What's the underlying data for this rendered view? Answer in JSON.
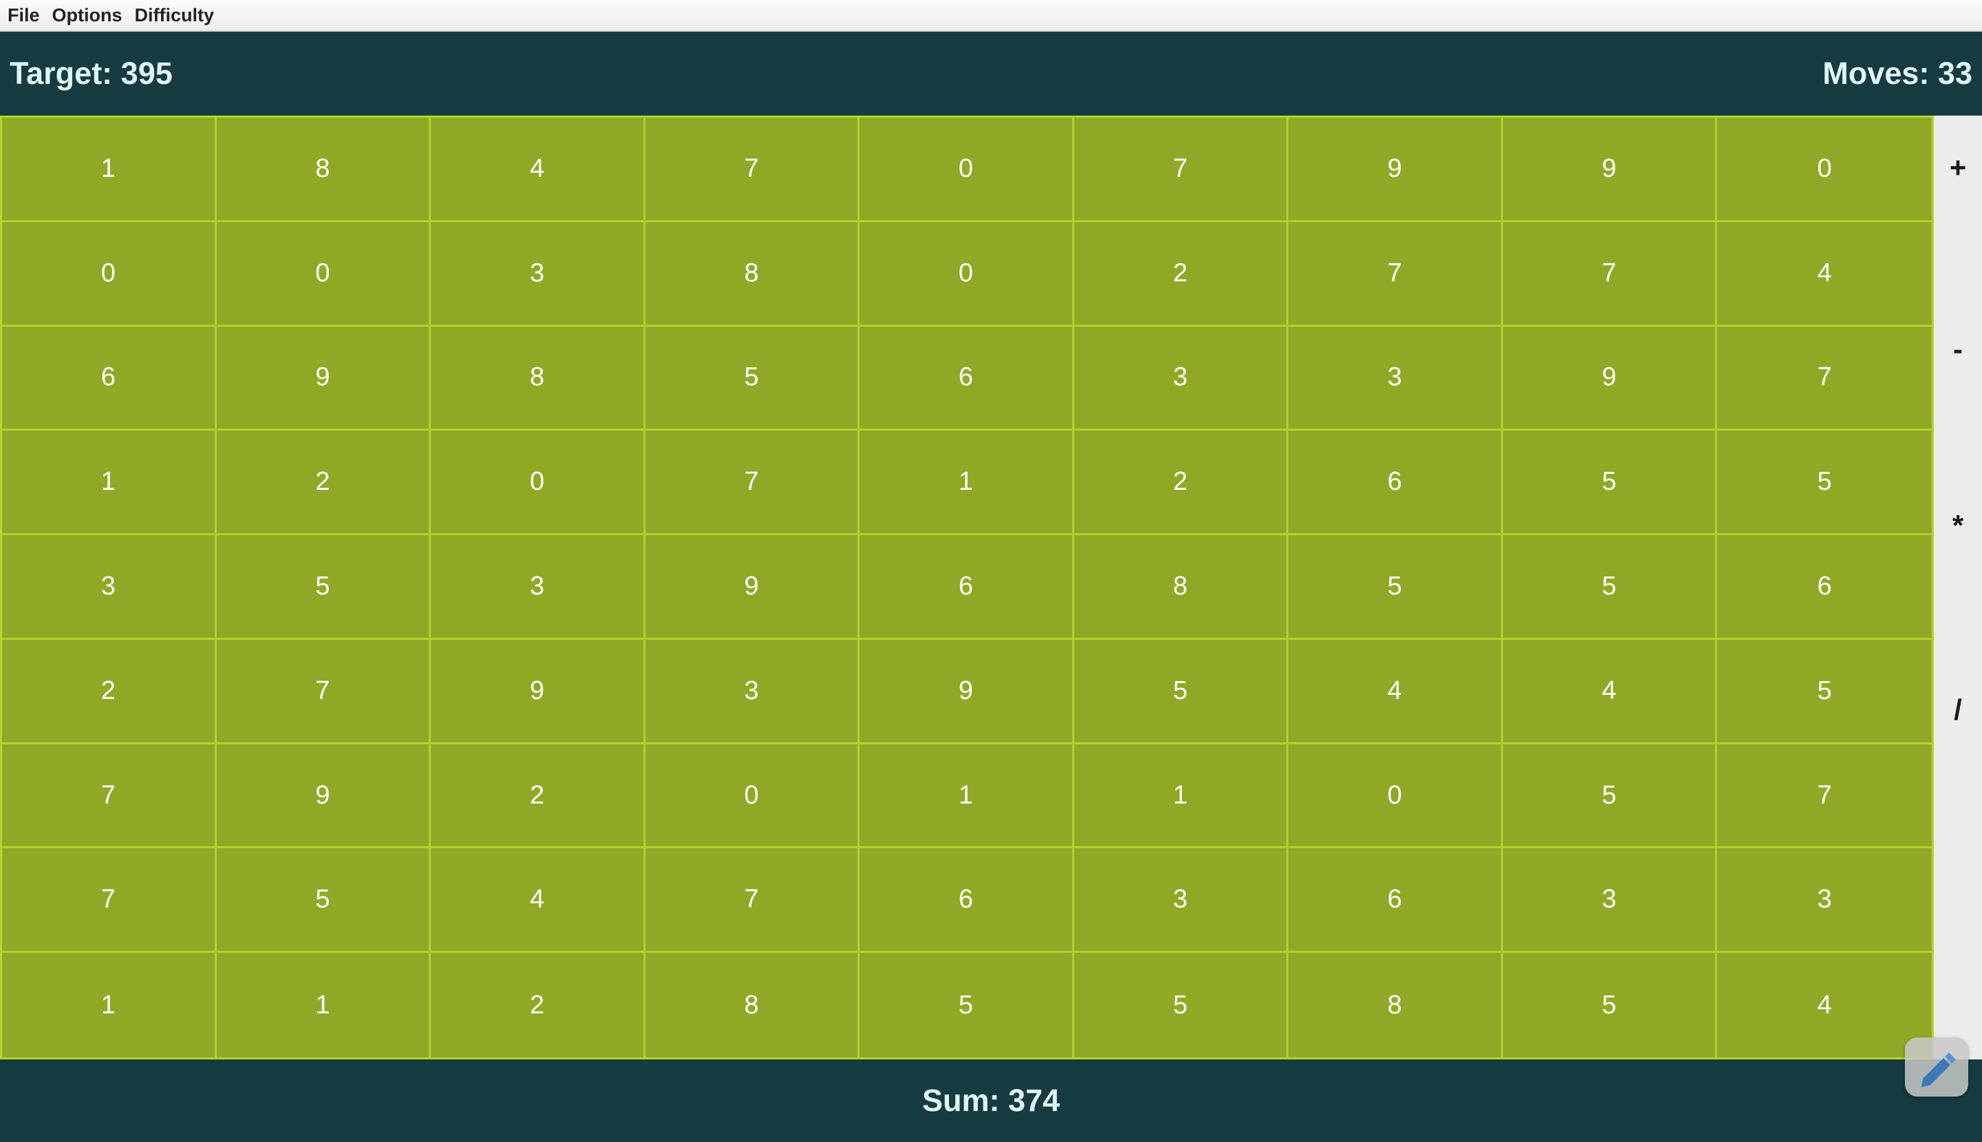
{
  "menu": {
    "items": [
      {
        "label": "File"
      },
      {
        "label": "Options"
      },
      {
        "label": "Difficulty"
      }
    ]
  },
  "header": {
    "target": "Target: 395",
    "moves": "Moves: 33"
  },
  "grid": {
    "rows": [
      [
        "1",
        "8",
        "4",
        "7",
        "0",
        "7",
        "9",
        "9",
        "0"
      ],
      [
        "0",
        "0",
        "3",
        "8",
        "0",
        "2",
        "7",
        "7",
        "4"
      ],
      [
        "6",
        "9",
        "8",
        "5",
        "6",
        "3",
        "3",
        "9",
        "7"
      ],
      [
        "1",
        "2",
        "0",
        "7",
        "1",
        "2",
        "6",
        "5",
        "5"
      ],
      [
        "3",
        "5",
        "3",
        "9",
        "6",
        "8",
        "5",
        "5",
        "6"
      ],
      [
        "2",
        "7",
        "9",
        "3",
        "9",
        "5",
        "4",
        "4",
        "5"
      ],
      [
        "7",
        "9",
        "2",
        "0",
        "1",
        "1",
        "0",
        "5",
        "7"
      ],
      [
        "7",
        "5",
        "4",
        "7",
        "6",
        "3",
        "6",
        "3",
        "3"
      ],
      [
        "1",
        "1",
        "2",
        "8",
        "5",
        "5",
        "8",
        "5",
        "4"
      ]
    ]
  },
  "operators": [
    "+",
    "-",
    "*",
    "/"
  ],
  "footer": {
    "sum": "Sum: 374"
  },
  "colors": {
    "header_bg": "#163b40",
    "grid_bg": "#8fa926",
    "grid_line": "#b2cf2f",
    "text_light": "#dff4f4"
  },
  "icons": {
    "corner_widget": "pencil-icon"
  }
}
